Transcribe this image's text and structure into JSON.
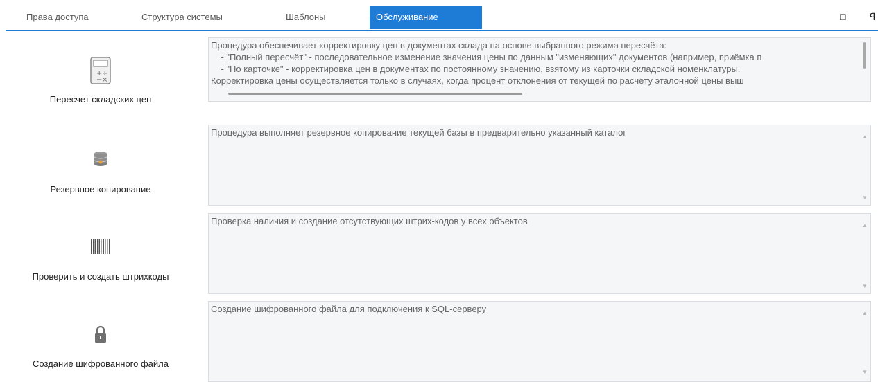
{
  "tabs": [
    {
      "label": "Права доступа",
      "active": false
    },
    {
      "label": "Структура системы",
      "active": false
    },
    {
      "label": "Шаблоны",
      "active": false
    },
    {
      "label": "Обслуживание",
      "active": true
    }
  ],
  "window_controls": {
    "restore_icon": "□",
    "pin_icon": "ꟼ"
  },
  "actions": [
    {
      "label": "Пересчет складских цен",
      "icon": "calculator-icon",
      "description": "Процедура обеспечивает корректировку цен в документах склада на основе выбранного режима пересчёта:\n    - \"Полный пересчёт\" - последовательное изменение значения цены по данным \"изменяющих\" документов (например, приёмка п\n    - \"По карточке\" - корректировка цен в документах по постоянному значению, взятому из карточки складской номенклатуры.\nКорректировка цены осуществляется только в случаях, когда процент отклонения от текущей по расчёту эталонной цены выш"
    },
    {
      "label": "Резервное копирование",
      "icon": "database-icon",
      "description": "Процедура выполняет резервное копирование текущей базы в предварительно указанный каталог"
    },
    {
      "label": "Проверить и создать штрихкоды",
      "icon": "barcode-icon",
      "description": "Проверка наличия и создание отсутствующих штрих-кодов у всех объектов"
    },
    {
      "label": "Создание шифрованного файла",
      "icon": "lock-icon",
      "description": "Создание шифрованного файла для подключения к SQL-серверу"
    }
  ],
  "colors": {
    "accent": "#1e7bd6",
    "panel_bg": "#f5f6f8"
  }
}
